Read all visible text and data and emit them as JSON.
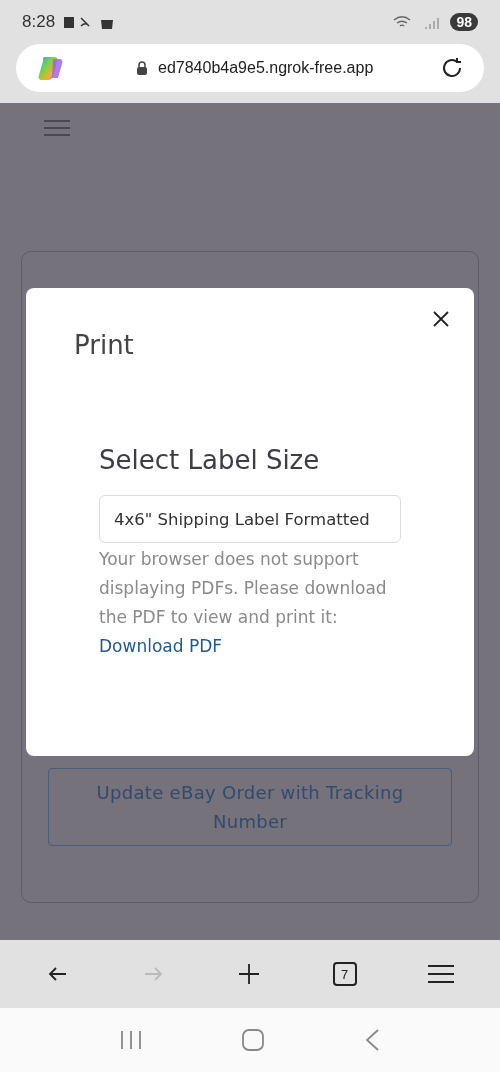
{
  "status_bar": {
    "time": "8:28",
    "battery": "98"
  },
  "address_bar": {
    "url": "ed7840b4a9e5.ngrok-free.app"
  },
  "page": {
    "card": {
      "button": "Update eBay Order with Tracking Number"
    }
  },
  "dialog": {
    "title": "Print",
    "heading": "Select Label Size",
    "select": {
      "value": "4x6\" Shipping Label Formatted"
    },
    "message": "Your browser does not support displaying PDFs. Please download the PDF to view and print it:",
    "link": "Download PDF"
  },
  "toolbar": {
    "forward_disabled": true,
    "tab_count": "7"
  }
}
